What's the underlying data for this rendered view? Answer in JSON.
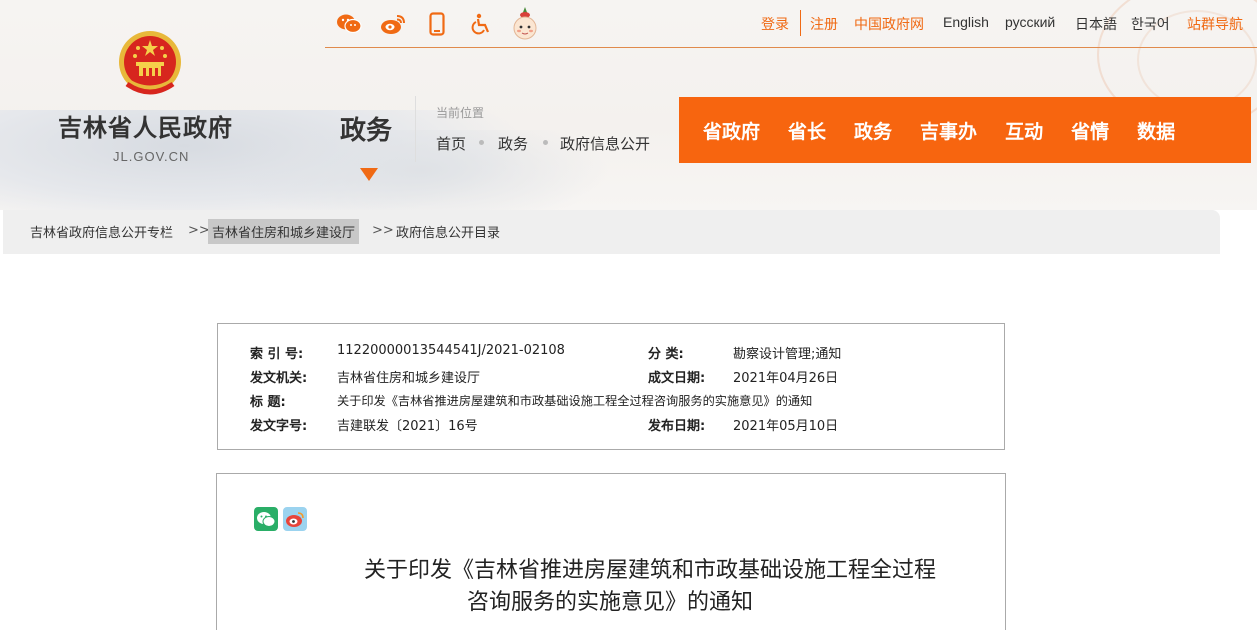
{
  "site": {
    "name": "吉林省人民政府",
    "domain": "JL.GOV.CN"
  },
  "top_icons": [
    "wechat-icon",
    "weibo-icon",
    "mobile-icon",
    "accessibility-icon",
    "mascot-icon"
  ],
  "top_links": {
    "login": "登录",
    "register": "注册",
    "gov_cn": "中国政府网",
    "english": "English",
    "russian": "русский",
    "japanese": "日本語",
    "korean": "한국어",
    "sitemap": "站群导航"
  },
  "section": {
    "title": "政务",
    "location_label": "当前位置",
    "breadcrumb": [
      "首页",
      "政务",
      "政府信息公开"
    ]
  },
  "main_nav": [
    "省政府",
    "省长",
    "政务",
    "吉事办",
    "互动",
    "省情",
    "数据"
  ],
  "path_bar": {
    "item1": "吉林省政府信息公开专栏",
    "sep": ">>",
    "item2": "吉林省住房和城乡建设厅",
    "item3": "政府信息公开目录"
  },
  "meta": {
    "index_label": "索 引 号:",
    "index_value": "11220000013544541J/2021-02108",
    "category_label": "分    类:",
    "category_value": "勘察设计管理;通知",
    "issuer_label": "发文机关:",
    "issuer_value": "吉林省住房和城乡建设厅",
    "written_label": "成文日期:",
    "written_value": "2021年04月26日",
    "title_label": "标      题:",
    "title_value": "关于印发《吉林省推进房屋建筑和市政基础设施工程全过程咨询服务的实施意见》的通知",
    "docno_label": "发文字号:",
    "docno_value": "吉建联发〔2021〕16号",
    "published_label": "发布日期:",
    "published_value": "2021年05月10日"
  },
  "document": {
    "title_line1": "关于印发《吉林省推进房屋建筑和市政基础设施工程全过程",
    "title_line2": "咨询服务的实施意见》的通知"
  },
  "colors": {
    "accent": "#f7650f",
    "link_orange": "#f06a14",
    "path_bar_bg": "#efefef"
  }
}
